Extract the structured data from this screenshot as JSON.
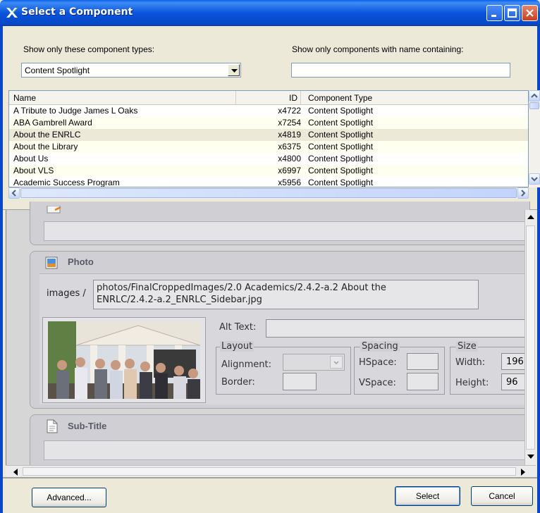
{
  "window": {
    "title": "Select a Component",
    "icon": "app-x-icon"
  },
  "filters": {
    "types_label": "Show only these component types:",
    "types_selected": "Content Spotlight",
    "name_label": "Show only components with name containing:",
    "name_value": ""
  },
  "list": {
    "columns": [
      "Name",
      "ID",
      "Component Type"
    ],
    "rows": [
      {
        "name": "A Tribute to Judge James L Oaks",
        "id": "x4722",
        "type": "Content Spotlight"
      },
      {
        "name": "ABA Gambrell Award",
        "id": "x7254",
        "type": "Content Spotlight"
      },
      {
        "name": "About the ENRLC",
        "id": "x4819",
        "type": "Content Spotlight"
      },
      {
        "name": "About the Library",
        "id": "x6375",
        "type": "Content Spotlight"
      },
      {
        "name": "About Us",
        "id": "x4800",
        "type": "Content Spotlight"
      },
      {
        "name": "About VLS",
        "id": "x6997",
        "type": "Content Spotlight"
      },
      {
        "name": "Academic Success Program",
        "id": "x5956",
        "type": "Content Spotlight"
      }
    ],
    "selected_index": 2
  },
  "editor": {
    "photo_title": "Photo",
    "images_prefix": "images /",
    "image_path_line1": "photos/FinalCroppedImages/2.0 Academics/2.4.2-a.2 About the",
    "image_path_line2": "ENRLC/2.4.2-a.2_ENRLC_Sidebar.jpg",
    "alt_text_label": "Alt Text:",
    "alt_text_value": "",
    "layout_legend": "Layout",
    "alignment_label": "Alignment:",
    "border_label": "Border:",
    "spacing_legend": "Spacing",
    "hspace_label": "HSpace:",
    "vspace_label": "VSpace:",
    "size_legend": "Size",
    "width_label": "Width:",
    "width_value": "196",
    "height_label": "Height:",
    "height_value": "96",
    "subtitle_title": "Sub-Title"
  },
  "buttons": {
    "advanced": "Advanced...",
    "select": "Select",
    "cancel": "Cancel"
  }
}
